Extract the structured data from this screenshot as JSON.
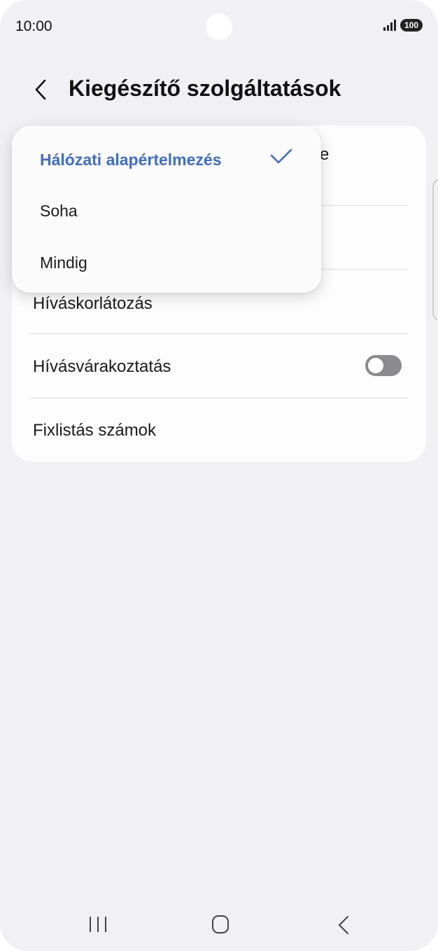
{
  "status_bar": {
    "time": "10:00",
    "battery": "100"
  },
  "header": {
    "title": "Kiegészítő szolgáltatások"
  },
  "settings": {
    "partial_letter": "e",
    "items": [
      {
        "label": "Híváskorlátozás"
      },
      {
        "label": "Hívásvárakoztatás",
        "toggle": "off"
      },
      {
        "label": "Fixlistás számok"
      }
    ]
  },
  "dropdown": {
    "options": [
      {
        "label": "Hálózati alapértelmezés",
        "selected": true
      },
      {
        "label": "Soha",
        "selected": false
      },
      {
        "label": "Mindig",
        "selected": false
      }
    ]
  },
  "colors": {
    "accent": "#3e6ccf",
    "background": "#f1f1f5",
    "toggle_off": "#8a8a8f"
  },
  "icons": {
    "back": "chevron-left-icon",
    "check": "checkmark-icon",
    "nav_recent": "recent-apps-icon",
    "nav_home": "home-icon",
    "nav_back": "back-icon"
  }
}
